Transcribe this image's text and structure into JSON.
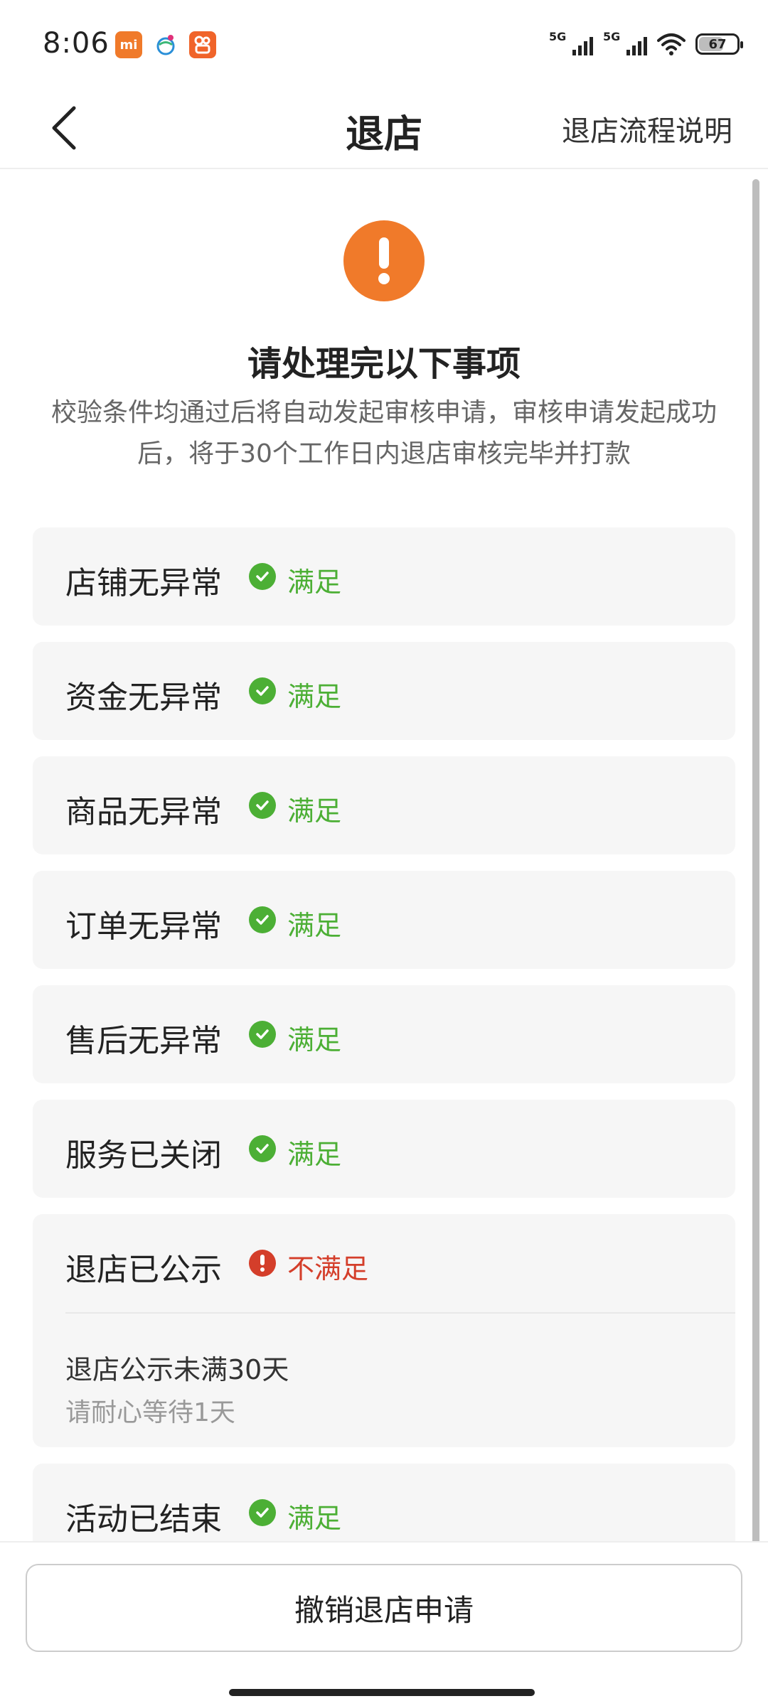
{
  "status_bar": {
    "time": "8:06",
    "apps": [
      "mi-app-icon",
      "globe-app-icon",
      "kwai-app-icon"
    ],
    "signal1_label": "5G",
    "signal2_label": "5G",
    "battery": "67"
  },
  "header": {
    "title": "退店",
    "link": "退店流程说明"
  },
  "notice": {
    "title": "请处理完以下事项",
    "description": "校验条件均通过后将自动发起审核申请，审核申请发起成功后，将于30个工作日内退店审核完毕并打款"
  },
  "checks": [
    {
      "name": "店铺无异常",
      "status": "满足",
      "ok": true
    },
    {
      "name": "资金无异常",
      "status": "满足",
      "ok": true
    },
    {
      "name": "商品无异常",
      "status": "满足",
      "ok": true
    },
    {
      "name": "订单无异常",
      "status": "满足",
      "ok": true
    },
    {
      "name": "售后无异常",
      "status": "满足",
      "ok": true
    },
    {
      "name": "服务已关闭",
      "status": "满足",
      "ok": true
    },
    {
      "name": "退店已公示",
      "status": "不满足",
      "ok": false,
      "detail": "退店公示未满30天",
      "hint": "请耐心等待1天"
    },
    {
      "name": "活动已结束",
      "status": "满足",
      "ok": true
    }
  ],
  "footer": {
    "cancel_label": "撤销退店申请"
  },
  "colors": {
    "accent": "#f07a2a",
    "ok": "#4caf35",
    "error": "#d43e2a"
  }
}
